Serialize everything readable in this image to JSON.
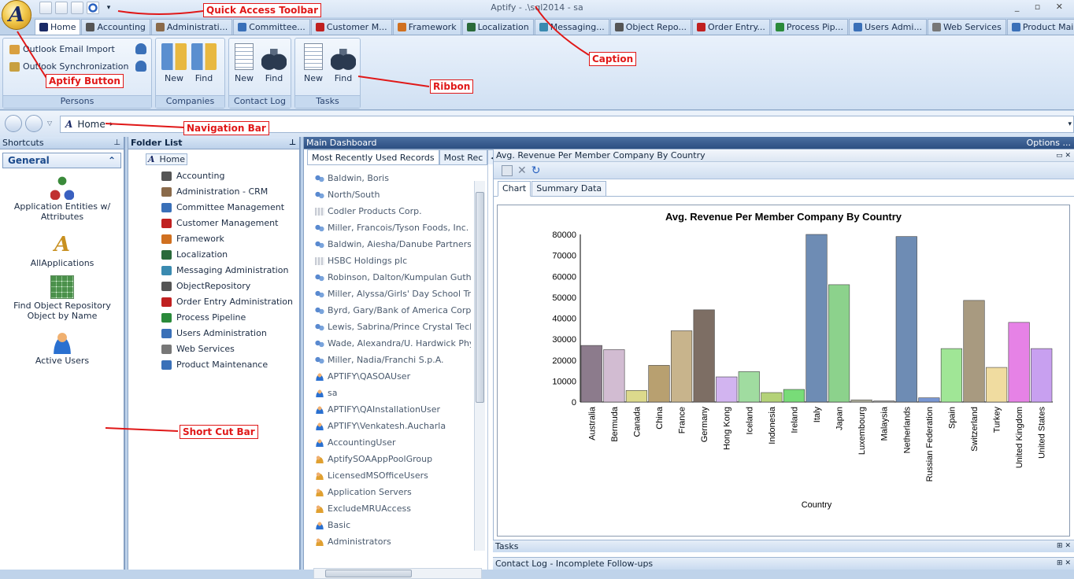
{
  "window": {
    "caption": "Aptify - .\\sql2014 - sa",
    "controls": "_ ▫ ✕"
  },
  "aptify_button": {
    "letter": "A"
  },
  "tabs": [
    {
      "label": "Home",
      "color": "#1a2a66"
    },
    {
      "label": "Accounting",
      "color": "#555555"
    },
    {
      "label": "Administrati...",
      "color": "#8a6a4a"
    },
    {
      "label": "Committee...",
      "color": "#3a70b8"
    },
    {
      "label": "Customer M...",
      "color": "#c02020"
    },
    {
      "label": "Framework",
      "color": "#d07020"
    },
    {
      "label": "Localization",
      "color": "#2a6a3a"
    },
    {
      "label": "Messaging...",
      "color": "#3a8ab0"
    },
    {
      "label": "Object Repo...",
      "color": "#555555"
    },
    {
      "label": "Order Entry...",
      "color": "#c02020"
    },
    {
      "label": "Process Pip...",
      "color": "#2a8a3a"
    },
    {
      "label": "Users Admi...",
      "color": "#3a70b8"
    },
    {
      "label": "Web Services",
      "color": "#777777"
    },
    {
      "label": "Product Mai...",
      "color": "#3a70b8"
    }
  ],
  "ribbon": {
    "persons": {
      "label": "Persons",
      "outlook_import": "Outlook Email Import",
      "outlook_sync": "Outlook Synchronization"
    },
    "companies": {
      "label": "Companies",
      "new": "New",
      "find": "Find"
    },
    "contact_log": {
      "label": "Contact Log",
      "new": "New",
      "find": "Find"
    },
    "tasks": {
      "label": "Tasks",
      "new": "New",
      "find": "Find"
    }
  },
  "navbar": {
    "path": "Home"
  },
  "shortcuts": {
    "header": "Shortcuts",
    "group": "General",
    "items": [
      {
        "label": "Application Entities w/ Attributes"
      },
      {
        "label": "AllApplications"
      },
      {
        "label": "Find Object Repository Object by Name"
      },
      {
        "label": "Active Users"
      }
    ]
  },
  "folders": {
    "header": "Folder List",
    "root": "Home",
    "items": [
      {
        "label": "Accounting",
        "color": "#555555"
      },
      {
        "label": "Administration - CRM",
        "color": "#8a6a4a"
      },
      {
        "label": "Committee Management",
        "color": "#3a70b8"
      },
      {
        "label": "Customer Management",
        "color": "#c02020"
      },
      {
        "label": "Framework",
        "color": "#d07020"
      },
      {
        "label": "Localization",
        "color": "#2a6a3a"
      },
      {
        "label": "Messaging Administration",
        "color": "#3a8ab0"
      },
      {
        "label": "ObjectRepository",
        "color": "#555555"
      },
      {
        "label": "Order Entry Administration",
        "color": "#c02020"
      },
      {
        "label": "Process Pipeline",
        "color": "#2a8a3a"
      },
      {
        "label": "Users Administration",
        "color": "#3a70b8"
      },
      {
        "label": "Web Services",
        "color": "#777777"
      },
      {
        "label": "Product Maintenance",
        "color": "#3a70b8"
      }
    ]
  },
  "dashboard": {
    "header": "Main Dashboard",
    "options": "Options ...",
    "mru_tabs": [
      "Most Recently Used Records",
      "Most Rec"
    ],
    "mru_items": [
      {
        "label": "Baldwin, Boris",
        "icon": "people"
      },
      {
        "label": "North/South",
        "icon": "people"
      },
      {
        "label": "Codler Products Corp.",
        "icon": "building"
      },
      {
        "label": "Miller, Francois/Tyson Foods, Inc.",
        "icon": "people"
      },
      {
        "label": "Baldwin, Aiesha/Danube Partners",
        "icon": "people"
      },
      {
        "label": "HSBC Holdings plc",
        "icon": "building"
      },
      {
        "label": "Robinson, Dalton/Kumpulan Guthrie",
        "icon": "people"
      },
      {
        "label": "Miller, Alyssa/Girls' Day School Trust",
        "icon": "people"
      },
      {
        "label": "Byrd, Gary/Bank of America Corporation",
        "icon": "people"
      },
      {
        "label": "Lewis, Sabrina/Prince Crystal Technology",
        "icon": "people"
      },
      {
        "label": "Wade, Alexandra/U. Hardwick Physics",
        "icon": "people"
      },
      {
        "label": "Miller, Nadia/Franchi S.p.A.",
        "icon": "people"
      },
      {
        "label": "APTIFY\\QASOAUser",
        "icon": "user"
      },
      {
        "label": "sa",
        "icon": "user"
      },
      {
        "label": "APTIFY\\QAInstallationUser",
        "icon": "user"
      },
      {
        "label": "APTIFY\\Venkatesh.Aucharla",
        "icon": "user"
      },
      {
        "label": "AccountingUser",
        "icon": "user"
      },
      {
        "label": "AptifySOAAppPoolGroup",
        "icon": "group"
      },
      {
        "label": "LicensedMSOfficeUsers",
        "icon": "group"
      },
      {
        "label": "Application Servers",
        "icon": "group"
      },
      {
        "label": "ExcludeMRUAccess",
        "icon": "group"
      },
      {
        "label": "Basic",
        "icon": "user"
      },
      {
        "label": "Administrators",
        "icon": "group"
      }
    ],
    "chart_pane_title": "Avg. Revenue Per Member Company By Country",
    "subtabs": [
      "Chart",
      "Summary Data"
    ],
    "bottom_panes": [
      "Tasks",
      "Contact Log - Incomplete Follow-ups"
    ]
  },
  "chart_data": {
    "type": "bar",
    "title": "Avg. Revenue Per Member Company By Country",
    "xlabel": "Country",
    "ylabel": "",
    "ylim": [
      0,
      80000
    ],
    "yticks": [
      0,
      10000,
      20000,
      30000,
      40000,
      50000,
      60000,
      70000,
      80000
    ],
    "categories": [
      "Australia",
      "Bermuda",
      "Canada",
      "China",
      "France",
      "Germany",
      "Hong Kong",
      "Iceland",
      "Indonesia",
      "Ireland",
      "Italy",
      "Japan",
      "Luxembourg",
      "Malaysia",
      "Netherlands",
      "Russian Federation",
      "Spain",
      "Switzerland",
      "Turkey",
      "United Kingdom",
      "United States"
    ],
    "values": [
      27000,
      25000,
      5500,
      17500,
      34000,
      44000,
      12000,
      14500,
      4500,
      6000,
      80000,
      56000,
      1000,
      500,
      79000,
      2000,
      25500,
      48500,
      16500,
      38000,
      25500
    ],
    "colors": [
      "#8c7b8c",
      "#d2bcd2",
      "#dcd98c",
      "#b8a070",
      "#c8b48c",
      "#7d6e64",
      "#d2b4f0",
      "#a0dca0",
      "#b4d278",
      "#78dc78",
      "#6e8cb4",
      "#8cd28c",
      "#b4b4a0",
      "#a0a0a0",
      "#6e8cb4",
      "#7896d2",
      "#a0e696",
      "#a89a80",
      "#f0dca0",
      "#e682e6",
      "#c8a0f0"
    ]
  },
  "annotations": {
    "qat": "Quick Access Toolbar",
    "caption": "Caption",
    "aptify": "Aptify Button",
    "ribbon": "Ribbon",
    "navbar": "Navigation Bar",
    "shortcut": "Short Cut Bar"
  }
}
